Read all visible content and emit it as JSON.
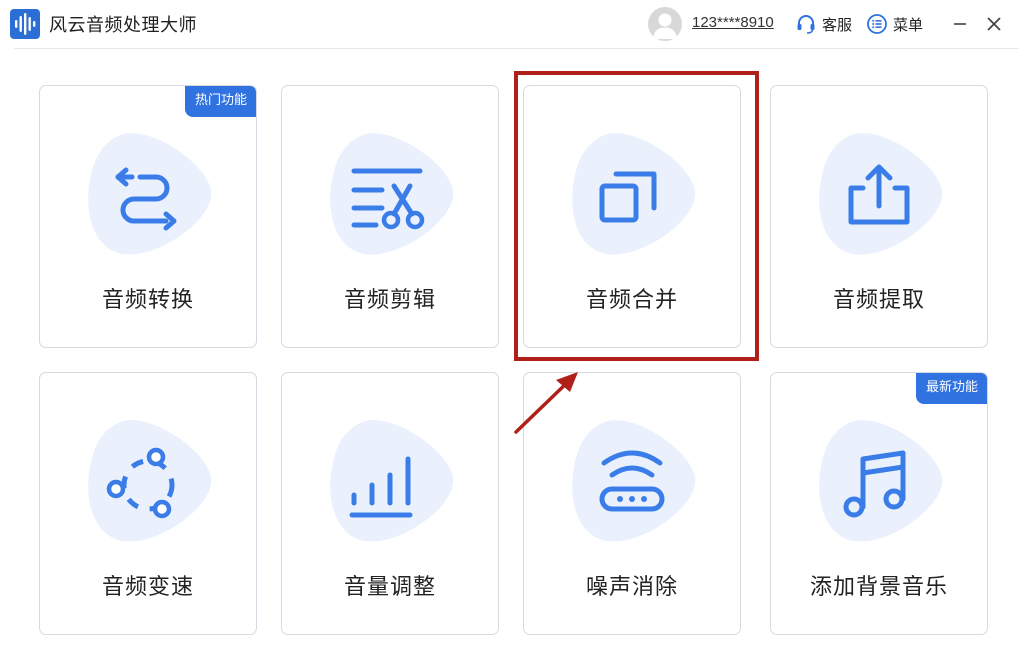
{
  "app": {
    "title": "风云音频处理大师"
  },
  "header": {
    "account": "123****8910",
    "service_label": "客服",
    "menu_label": "菜单"
  },
  "cards": [
    {
      "label": "音频转换",
      "badge": "热门功能"
    },
    {
      "label": "音频剪辑"
    },
    {
      "label": "音频合并"
    },
    {
      "label": "音频提取"
    },
    {
      "label": "音频变速"
    },
    {
      "label": "音量调整"
    },
    {
      "label": "噪声消除"
    },
    {
      "label": "添加背景音乐",
      "badge": "最新功能"
    }
  ],
  "colors": {
    "accent": "#2f72e0",
    "icon": "#3b7de8",
    "blob": "#eaf1fd",
    "highlight": "#b0201b"
  }
}
